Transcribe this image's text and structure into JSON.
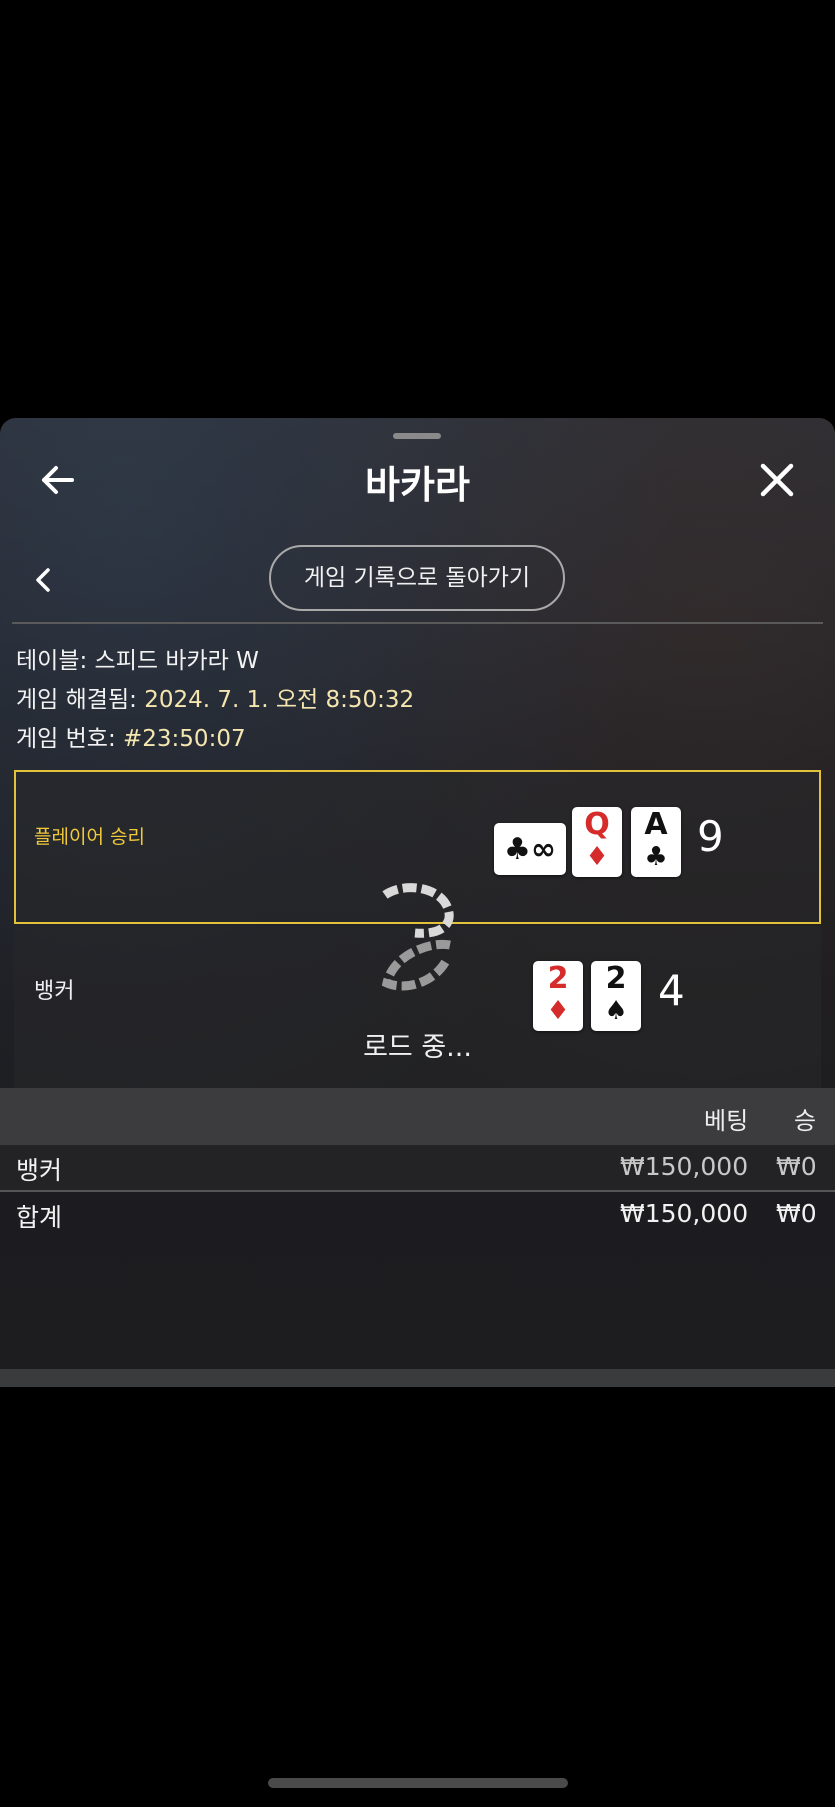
{
  "header": {
    "title": "바카라",
    "back_button_text": "게임 기록으로 돌아가기"
  },
  "info": {
    "table_label": "테이블:",
    "table_value": "스피드 바카라 W",
    "resolved_label": "게임 해결됨:",
    "resolved_value": "2024. 7. 1. 오전 8:50:32",
    "round_label": "게임 번호:",
    "round_value": "#23:50:07"
  },
  "player": {
    "label": "플레이어 승리",
    "cards": [
      {
        "rank": "Q",
        "suit": "♦",
        "color": "#d62b2b"
      },
      {
        "rank": "A",
        "suit": "♣",
        "color": "#111111"
      }
    ],
    "side_card": {
      "suit": "♣",
      "rank": "∞"
    },
    "score": "9"
  },
  "banker": {
    "label": "뱅커",
    "cards": [
      {
        "rank": "2",
        "suit": "♦",
        "color": "#d62b2b"
      },
      {
        "rank": "2",
        "suit": "♠",
        "color": "#111111"
      }
    ],
    "score": "4"
  },
  "loading_text": "로드 중...",
  "table": {
    "headers": [
      "베팅",
      "승"
    ],
    "rows": [
      {
        "label": "뱅커",
        "bet": "₩150,000",
        "win": "₩0"
      },
      {
        "label": "합계",
        "bet": "₩150,000",
        "win": "₩0"
      }
    ]
  },
  "colors": {
    "accent_gold": "#e2c23a",
    "card_red": "#d62b2b"
  }
}
